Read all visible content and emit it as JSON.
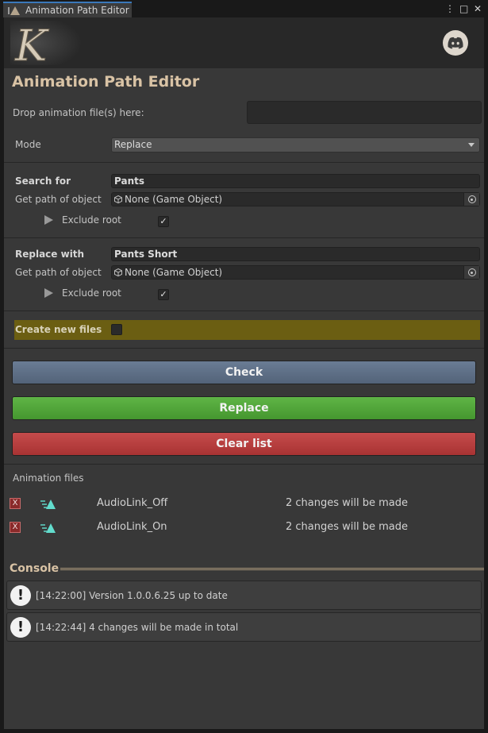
{
  "window": {
    "tab_title": "Animation Path Editor",
    "controls": [
      "⋮",
      "□",
      "✕"
    ]
  },
  "header": {
    "logo_text": "K",
    "discord_icon": "discord-icon"
  },
  "editor": {
    "title": "Animation Path Editor",
    "drop_label": "Drop animation file(s) here:",
    "mode_label": "Mode",
    "mode_value": "Replace",
    "search": {
      "label": "Search for",
      "value": "Pants",
      "get_path_label": "Get path of object",
      "object_value": "None (Game Object)",
      "exclude_root_label": "Exclude root",
      "exclude_root_checked": true
    },
    "replace": {
      "label": "Replace with",
      "value": "Pants Short",
      "get_path_label": "Get path of object",
      "object_value": "None (Game Object)",
      "exclude_root_label": "Exclude root",
      "exclude_root_checked": true
    },
    "create_new_files_label": "Create new files",
    "create_new_files_checked": false,
    "buttons": {
      "check": "Check",
      "replace": "Replace",
      "clear": "Clear list"
    },
    "colors": {
      "check": "#5f6f87",
      "replace": "#52a73b",
      "clear": "#b93d3d",
      "create_row": "#6b5e12",
      "accent_text": "#d9c3a5"
    }
  },
  "files": {
    "header": "Animation files",
    "remove_label": "X",
    "items": [
      {
        "name": "AudioLink_Off",
        "changes": "2 changes will be made"
      },
      {
        "name": "AudioLink_On",
        "changes": "2 changes will be made"
      }
    ]
  },
  "console": {
    "title": "Console",
    "messages": [
      {
        "text": "[14:22:00] Version 1.0.0.6.25 up to date"
      },
      {
        "text": "[14:22:44] 4 changes will be made in total"
      }
    ]
  }
}
